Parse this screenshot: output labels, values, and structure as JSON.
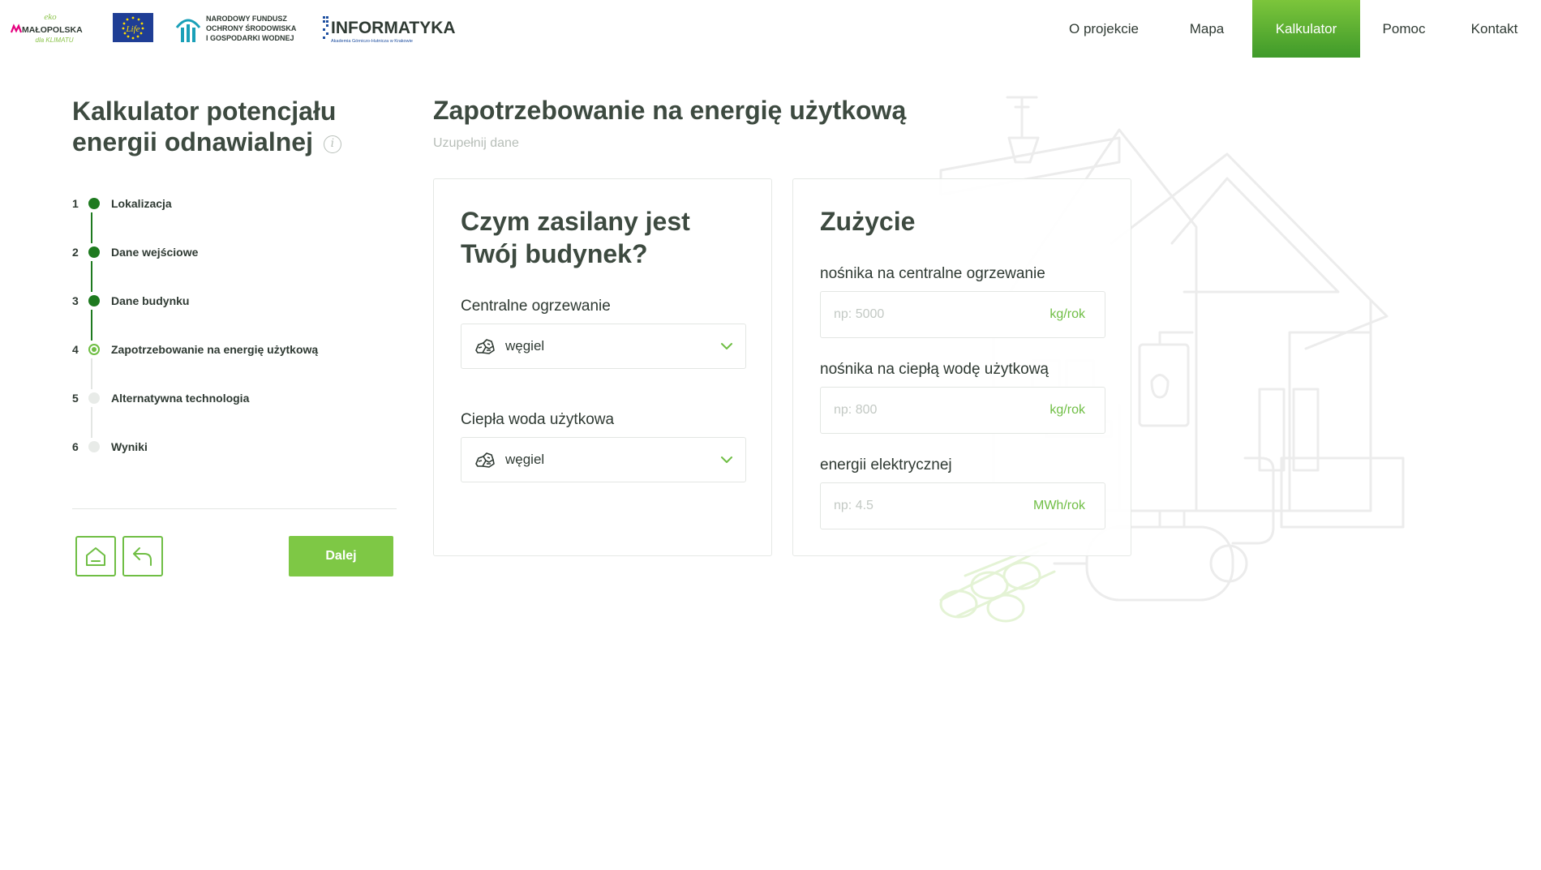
{
  "header": {
    "logos": {
      "eko_small": "eko",
      "malopolska": "MAŁOPOLSKA",
      "dla_klimatu": "dla KLIMATU",
      "life": "Life",
      "nfosigw_line1": "NARODOWY FUNDUSZ",
      "nfosigw_line2": "OCHRONY ŚRODOWISKA",
      "nfosigw_line3": "I GOSPODARKI WODNEJ",
      "informatyka": "INFORMATYKA",
      "informatyka_sub": "Akademia Górniczo-Hutnicza w Krakowie"
    },
    "nav": [
      {
        "label": "O projekcie",
        "active": false
      },
      {
        "label": "Mapa",
        "active": false
      },
      {
        "label": "Kalkulator",
        "active": true
      },
      {
        "label": "Pomoc",
        "active": false
      },
      {
        "label": "Kontakt",
        "active": false
      }
    ]
  },
  "sidebar": {
    "title": "Kalkulator potencjału energii odnawialnej",
    "info_icon": "i",
    "steps": [
      {
        "num": "1",
        "label": "Lokalizacja",
        "state": "done"
      },
      {
        "num": "2",
        "label": "Dane wejściowe",
        "state": "done"
      },
      {
        "num": "3",
        "label": "Dane budynku",
        "state": "done"
      },
      {
        "num": "4",
        "label": "Zapotrzebowanie na energię użytkową",
        "state": "current"
      },
      {
        "num": "5",
        "label": "Alternatywna technologia",
        "state": "todo"
      },
      {
        "num": "6",
        "label": "Wyniki",
        "state": "todo"
      }
    ],
    "next_label": "Dalej",
    "home_icon": "home-icon",
    "back_icon": "back-arrow-icon"
  },
  "main": {
    "heading": "Zapotrzebowanie na energię użytkową",
    "subheading": "Uzupełnij dane",
    "supply_card": {
      "title": "Czym zasilany jest Twój budynek?",
      "heating_label": "Centralne ogrzewanie",
      "heating_value": "węgiel",
      "water_label": "Ciepła woda użytkowa",
      "water_value": "węgiel"
    },
    "usage_card": {
      "title": "Zużycie",
      "fields": [
        {
          "label": "nośnika na centralne ogrzewanie",
          "placeholder": "np: 5000",
          "unit": "kg/rok"
        },
        {
          "label": "nośnika na ciepłą wodę użytkową",
          "placeholder": "np: 800",
          "unit": "kg/rok"
        },
        {
          "label": "energii elektrycznej",
          "placeholder": "np: 4.5",
          "unit": "MWh/rok"
        }
      ]
    }
  },
  "colors": {
    "accent_green": "#7ec845",
    "dark_green": "#1e7a1f",
    "text_dark": "#3d4a40",
    "muted": "#b7beb8"
  }
}
